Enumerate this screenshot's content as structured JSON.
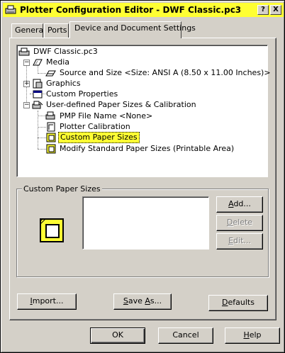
{
  "window": {
    "title": "Plotter Configuration Editor - DWF Classic.pc3",
    "help_button": "?",
    "close_button": "X",
    "title_color": "#ffff33"
  },
  "tabs": [
    {
      "label": "General"
    },
    {
      "label": "Ports"
    },
    {
      "label": "Device and Document Settings",
      "active": true
    }
  ],
  "tree": {
    "items": [
      {
        "label": "DWF Classic.pc3",
        "icon": "plotter-icon"
      },
      {
        "label": "Media",
        "icon": "media-icon"
      },
      {
        "label": "Source and Size <Size: ANSI A (8.50 x 11.00 Inches)>",
        "icon": "paper-source-icon"
      },
      {
        "label": "Graphics",
        "icon": "graphics-icon"
      },
      {
        "label": "Custom Properties",
        "icon": "custom-properties-icon"
      },
      {
        "label": "User-defined Paper Sizes & Calibration",
        "icon": "user-defined-icon"
      },
      {
        "label": "PMP File Name <None>",
        "icon": "pmp-file-icon"
      },
      {
        "label": "Plotter Calibration",
        "icon": "calibration-icon"
      },
      {
        "label": "Custom Paper Sizes",
        "icon": "custom-paper-icon",
        "selected": true
      },
      {
        "label": "Modify Standard Paper Sizes (Printable Area)",
        "icon": "modify-paper-icon"
      }
    ],
    "selection_color": "#ffff33"
  },
  "custom_paper_sizes": {
    "group_title": "Custom Paper Sizes",
    "add_prefix": "A",
    "add_rest": "dd...",
    "delete_prefix": "D",
    "delete_rest": "elete",
    "edit_prefix": "E",
    "edit_rest": "dit..."
  },
  "bottom_buttons": {
    "import_prefix": "I",
    "import_rest": "mport...",
    "saveas_first": "S",
    "saveas_mid": "ave ",
    "saveas_u": "A",
    "saveas_rest": "s...",
    "defaults_prefix": "D",
    "defaults_rest": "efaults"
  },
  "dialog_buttons": {
    "ok": "OK",
    "cancel": "Cancel",
    "help_prefix": "H",
    "help_rest": "elp"
  }
}
